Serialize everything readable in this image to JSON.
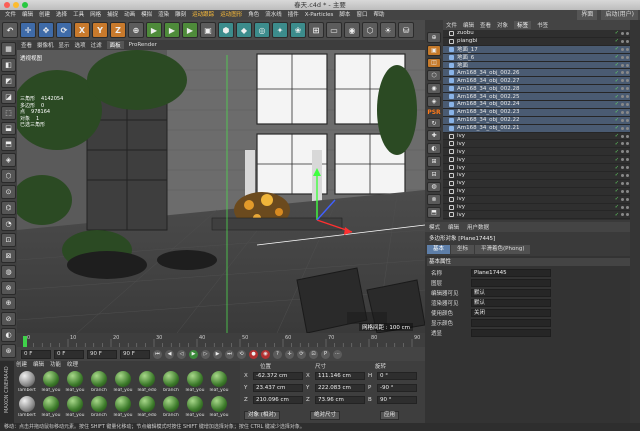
{
  "window": {
    "title": "春天.c4d * - 主要"
  },
  "menubar": {
    "items": [
      "文件",
      "编辑",
      "创建",
      "选择",
      "工具",
      "网格",
      "捕捉",
      "动画",
      "模拟",
      "渲染",
      "雕刻",
      "运动跟踪",
      "运动图形",
      "角色",
      "流水线",
      "插件",
      "X-Particles",
      "脚本",
      "窗口",
      "帮助"
    ],
    "highlight_indexes": [
      11,
      12
    ],
    "right": [
      "界面",
      "启动(用户)"
    ]
  },
  "toolbar": {
    "buttons": [
      "↶",
      "✛",
      "✥",
      "⟳",
      "X",
      "Y",
      "Z",
      "⊕",
      "▶",
      "▶",
      "▶",
      "▣",
      "⬢",
      "◆",
      "◎",
      "✦",
      "❀",
      "⊞",
      "▭",
      "◉",
      "⬡",
      "☀",
      "⛁"
    ]
  },
  "left_tools": [
    "▦",
    "◧",
    "◩",
    "◪",
    "⬚",
    "⬓",
    "⬒",
    "◈",
    "⬡",
    "⊙",
    "⌬",
    "◔",
    "⊡",
    "⊠",
    "◍",
    "⊗",
    "⊕",
    "⊘",
    "◐",
    "⊛"
  ],
  "viewport": {
    "menu": [
      "查看",
      "摄像机",
      "显示",
      "选项",
      "过滤",
      "面板",
      "ProRender"
    ],
    "active_menu_index": 5,
    "label": "透视视图",
    "stats": [
      {
        "k": "三角形",
        "v": "4142054"
      },
      {
        "k": "多边形",
        "v": "0"
      },
      {
        "k": "点",
        "v": "978164"
      },
      {
        "k": "对象",
        "v": "1"
      },
      {
        "k": "已选三角形",
        "v": ""
      }
    ],
    "grid_label": "网格间距 : 100 cm"
  },
  "timeline": {
    "ticks": [
      "0",
      "10",
      "20",
      "30",
      "40",
      "50",
      "60",
      "70",
      "80",
      "90"
    ]
  },
  "transport": {
    "start": "0 F",
    "current": "0 F",
    "end": "90 F",
    "end2": "90 F"
  },
  "materials": {
    "menu": [
      "创建",
      "编辑",
      "功能",
      "纹理"
    ],
    "items": [
      {
        "name": "lambert",
        "grey": true
      },
      {
        "name": "leaf_you",
        "grey": false
      },
      {
        "name": "leaf_you",
        "grey": false
      },
      {
        "name": "branch",
        "grey": false
      },
      {
        "name": "leaf_you",
        "grey": false
      },
      {
        "name": "leaf_edo",
        "grey": false
      },
      {
        "name": "branch",
        "grey": false
      },
      {
        "name": "leaf_you",
        "grey": false
      },
      {
        "name": "leaf_you",
        "grey": false
      },
      {
        "name": "lambert",
        "grey": true
      },
      {
        "name": "leaf_you",
        "grey": false
      },
      {
        "name": "leaf_you",
        "grey": false
      },
      {
        "name": "branch",
        "grey": false
      },
      {
        "name": "leaf_you",
        "grey": false
      },
      {
        "name": "leaf_edo",
        "grey": false
      },
      {
        "name": "branch",
        "grey": false
      },
      {
        "name": "leaf_you",
        "grey": false
      },
      {
        "name": "leaf_you",
        "grey": false
      }
    ]
  },
  "coords": {
    "headers": [
      "位置",
      "尺寸",
      "旋转"
    ],
    "rows": [
      {
        "axis": "X",
        "pos": "-62.372 cm",
        "size": "111.146 cm",
        "rlabel": "H",
        "rot": "0 °"
      },
      {
        "axis": "Y",
        "pos": "23.437 cm",
        "size": "222.083 cm",
        "rlabel": "P",
        "rot": "-90 °"
      },
      {
        "axis": "Z",
        "pos": "210.096 cm",
        "size": "73.96 cm",
        "rlabel": "B",
        "rot": "90 °"
      }
    ],
    "mode": "对象 (相对)",
    "size_mode": "绝对尺寸",
    "apply": "应用"
  },
  "status": "移动：点击并拖动鼠标移动元素。按住 SHIFT 键量化移动；节点编辑模式时按住 SHIFT 键增加选择对象；按住 CTRL 键减少选择对象。",
  "objects": {
    "menu": [
      "文件",
      "编辑",
      "查看",
      "对象",
      "标签",
      "书签"
    ],
    "active_menu_index": 4,
    "rows": [
      {
        "name": "zuobu",
        "null": true,
        "sel": false
      },
      {
        "name": "piangbi",
        "null": true,
        "sel": false
      },
      {
        "name": "地面_17",
        "null": false,
        "sel": true
      },
      {
        "name": "地面_6",
        "null": false,
        "sel": true
      },
      {
        "name": "地面",
        "null": false,
        "sel": true
      },
      {
        "name": "Am168_34_obj_002.26",
        "null": false,
        "sel": true
      },
      {
        "name": "Am168_34_obj_002.27",
        "null": false,
        "sel": true
      },
      {
        "name": "Am168_34_obj_002.28",
        "null": false,
        "sel": true
      },
      {
        "name": "Am168_34_obj_002.25",
        "null": false,
        "sel": true
      },
      {
        "name": "Am168_34_obj_002.24",
        "null": false,
        "sel": true
      },
      {
        "name": "Am168_34_obj_002.23",
        "null": false,
        "sel": true
      },
      {
        "name": "Am168_34_obj_002.22",
        "null": false,
        "sel": true
      },
      {
        "name": "Am168_34_obj_002.21",
        "null": false,
        "sel": true
      },
      {
        "name": "ivy",
        "null": true,
        "sel": false
      },
      {
        "name": "ivy",
        "null": true,
        "sel": false
      },
      {
        "name": "ivy",
        "null": true,
        "sel": false
      },
      {
        "name": "ivy",
        "null": true,
        "sel": false
      },
      {
        "name": "ivy",
        "null": true,
        "sel": false
      },
      {
        "name": "ivy",
        "null": true,
        "sel": false
      },
      {
        "name": "ivy",
        "null": true,
        "sel": false
      },
      {
        "name": "ivy",
        "null": true,
        "sel": false
      },
      {
        "name": "ivy",
        "null": true,
        "sel": false
      },
      {
        "name": "ivy",
        "null": true,
        "sel": false
      },
      {
        "name": "ivy",
        "null": true,
        "sel": false
      }
    ]
  },
  "attributes": {
    "menu": [
      "模式",
      "编辑",
      "用户数据"
    ],
    "title": "多边形对象 [Plane17445]",
    "tabs": [
      "基本",
      "坐标",
      "平滑着色(Phong)"
    ],
    "active_tab_index": 0,
    "section": "基本属性",
    "fields": [
      {
        "label": "名称",
        "value": "Plane17445"
      },
      {
        "label": "图层",
        "value": ""
      },
      {
        "label": "编辑器可见",
        "value": "默认"
      },
      {
        "label": "渲染器可见",
        "value": "默认"
      },
      {
        "label": "使用颜色",
        "value": "关闭"
      },
      {
        "label": "显示颜色",
        "value": ""
      },
      {
        "label": "透显",
        "value": ""
      }
    ]
  }
}
